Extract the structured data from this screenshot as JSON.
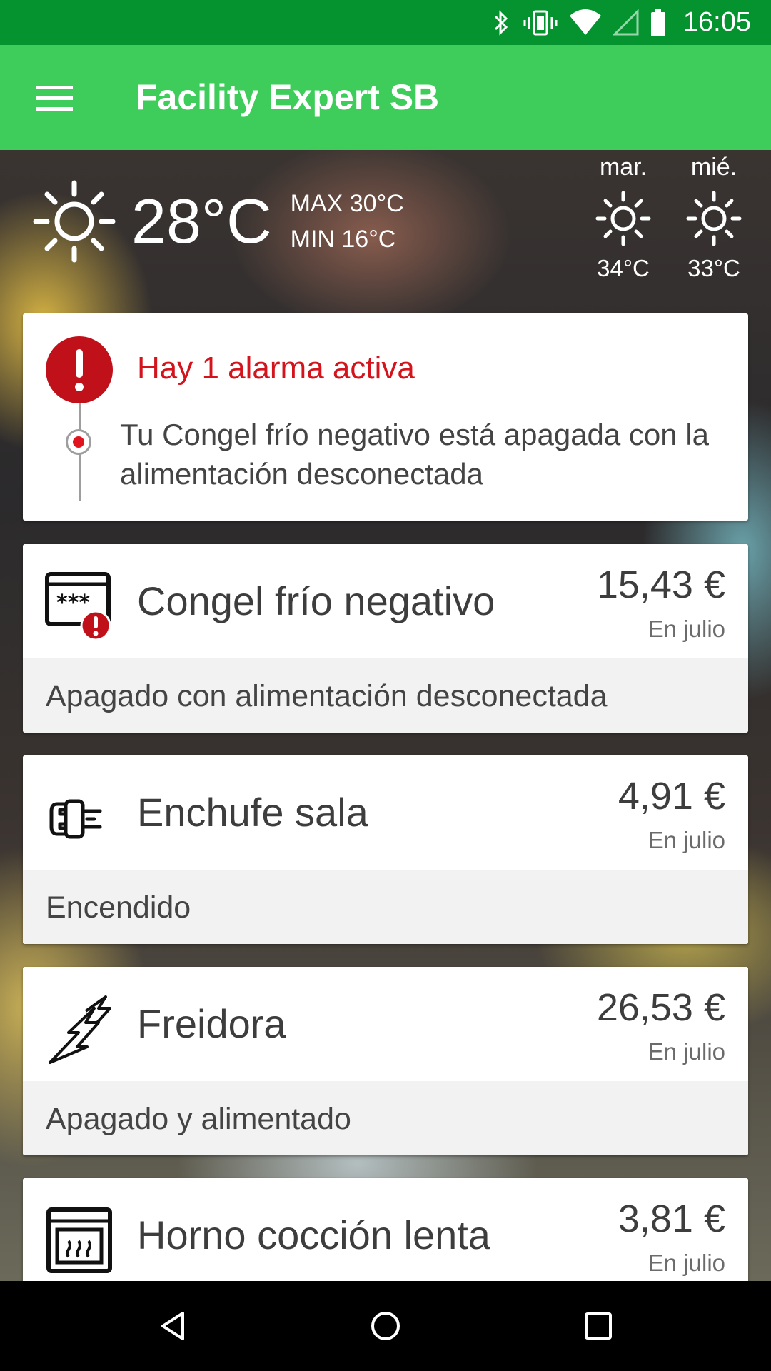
{
  "status_bar": {
    "time": "16:05",
    "icons": [
      "bluetooth-icon",
      "vibrate-icon",
      "wifi-icon",
      "signal-icon",
      "battery-icon"
    ]
  },
  "app_bar": {
    "title": "Facility Expert SB",
    "menu_icon": "menu-icon",
    "background_color": "#3ecd5a"
  },
  "weather": {
    "current": {
      "icon": "sun-icon",
      "temp": "28°C",
      "max": "MAX 30°C",
      "min": "MIN 16°C"
    },
    "forecast": [
      {
        "day": "mar.",
        "icon": "sun-icon",
        "temp": "34°C"
      },
      {
        "day": "mié.",
        "icon": "sun-icon",
        "temp": "33°C"
      }
    ]
  },
  "alarm": {
    "title": "Hay 1 alarma activa",
    "message": "Tu Congel frío negativo está apagada con la alimentación desconectada",
    "color": "#d3141d"
  },
  "devices": [
    {
      "name": "Congel frío negativo",
      "price": "15,43 €",
      "period": "En julio",
      "status": "Apagado con alimentación desconectada",
      "icon": "freezer-alarm-icon"
    },
    {
      "name": "Enchufe sala",
      "price": "4,91 €",
      "period": "En julio",
      "status": "Encendido",
      "icon": "plug-icon"
    },
    {
      "name": "Freidora",
      "price": "26,53 €",
      "period": "En julio",
      "status": "Apagado y alimentado",
      "icon": "lightning-icon"
    },
    {
      "name": "Horno cocción lenta",
      "price": "3,81 €",
      "period": "En julio",
      "status": "",
      "icon": "oven-icon"
    }
  ],
  "nav_bar": {
    "buttons": [
      "back-icon",
      "home-icon",
      "recents-icon"
    ]
  }
}
